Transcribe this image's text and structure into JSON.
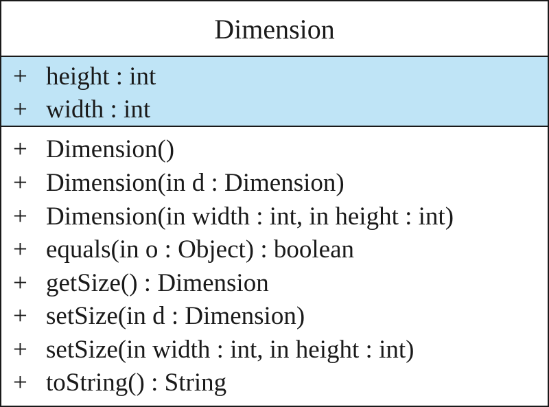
{
  "class": {
    "name": "Dimension",
    "attributes": [
      {
        "visibility": "+",
        "text": "height : int"
      },
      {
        "visibility": "+",
        "text": "width : int"
      }
    ],
    "operations": [
      {
        "visibility": "+",
        "text": "Dimension()"
      },
      {
        "visibility": "+",
        "text": "Dimension(in d : Dimension)"
      },
      {
        "visibility": "+",
        "text": "Dimension(in width : int, in height : int)"
      },
      {
        "visibility": "+",
        "text": "equals(in o : Object) : boolean"
      },
      {
        "visibility": "+",
        "text": "getSize() : Dimension"
      },
      {
        "visibility": "+",
        "text": "setSize(in d : Dimension)"
      },
      {
        "visibility": "+",
        "text": "setSize(in width : int, in height : int)"
      },
      {
        "visibility": "+",
        "text": "toString() : String"
      }
    ]
  },
  "colors": {
    "attributes_background": "#bfe4f6",
    "border": "#1a1a1a"
  }
}
